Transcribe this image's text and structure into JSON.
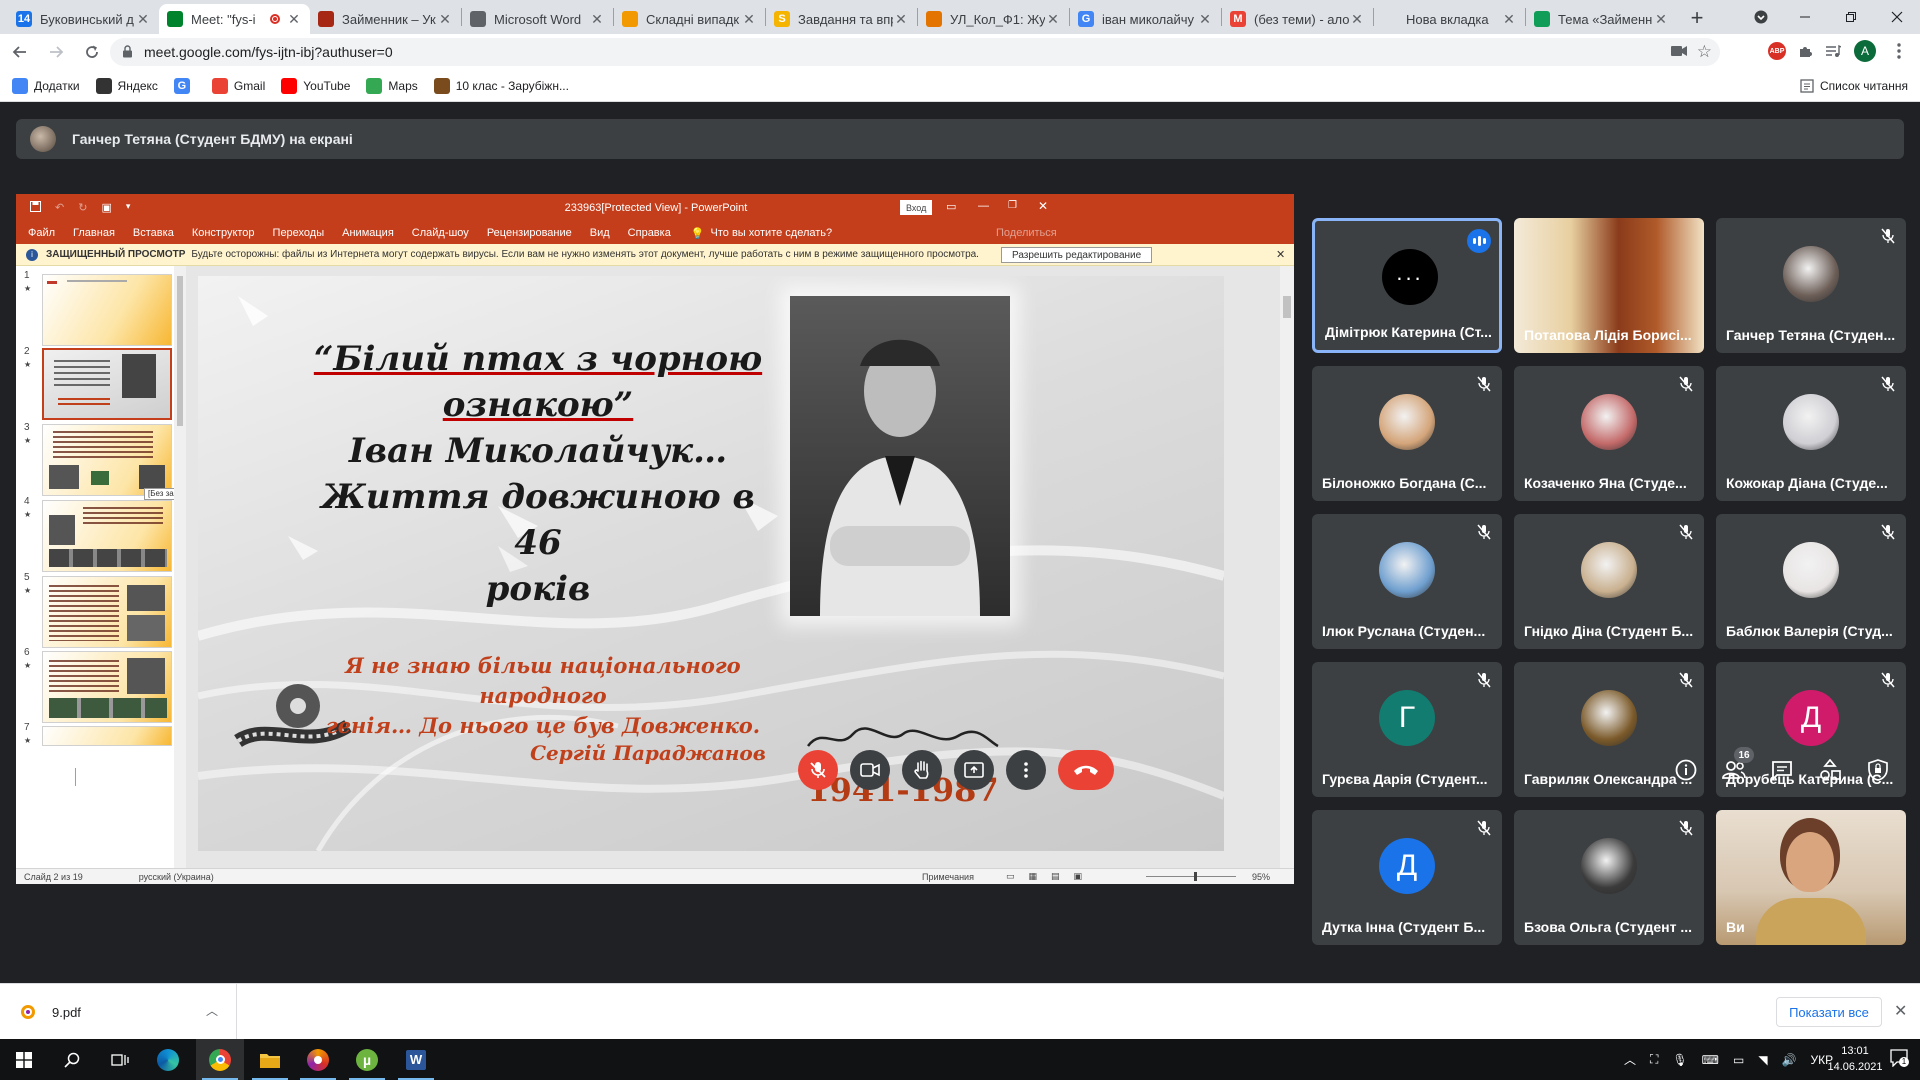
{
  "browser": {
    "tabs": [
      {
        "title": "Буковинський д",
        "color": "#1a73e8",
        "letter": "14"
      },
      {
        "title": "Meet: \"fys-i",
        "color": "#00832d",
        "letter": "",
        "active": true,
        "recording": true
      },
      {
        "title": "Займенник – Ук",
        "color": "#a52714",
        "letter": ""
      },
      {
        "title": "Microsoft Word",
        "color": "#5f6368",
        "letter": ""
      },
      {
        "title": "Складні випадк",
        "color": "#f29900",
        "letter": ""
      },
      {
        "title": "Завдання та впр",
        "color": "#f4b400",
        "letter": "S"
      },
      {
        "title": "УЛ_Кол_Ф1: Жу",
        "color": "#e37400",
        "letter": ""
      },
      {
        "title": "іван миколайчу",
        "color": "#4285f4",
        "letter": "G"
      },
      {
        "title": "(без теми) - ало",
        "color": "#ea4335",
        "letter": "M"
      },
      {
        "title": "Нова вкладка",
        "color": "#dee1e6",
        "letter": ""
      },
      {
        "title": "Тема «Займенн",
        "color": "#0f9d58",
        "letter": ""
      }
    ],
    "url": "meet.google.com/fys-ijtn-ibj?authuser=0",
    "bookmarks": [
      {
        "label": "Додатки",
        "color": "#4285f4"
      },
      {
        "label": "Яндекс",
        "color": "#333333"
      },
      {
        "label": "",
        "color": "#4285f4",
        "letter": "G"
      },
      {
        "label": "Gmail",
        "color": "#ea4335"
      },
      {
        "label": "YouTube",
        "color": "#ff0000"
      },
      {
        "label": "Maps",
        "color": "#34a853"
      },
      {
        "label": "10 клас - Зарубіжн...",
        "color": "#7a4b1c"
      }
    ],
    "reading_list": "Список читання",
    "profile_letter": "A"
  },
  "meet": {
    "presenter_text": "Ганчер Тетяна (Студент БДМУ) на екрані",
    "time": "13:01",
    "meeting_code": "fys-ijtn-ibj",
    "participants_count": "16",
    "tiles": [
      {
        "name": "Дімітрюк Катерина (Ст...",
        "type": "dots",
        "speaking": true
      },
      {
        "name": "Потапова Лідія Борисі...",
        "type": "video"
      },
      {
        "name": "Ганчер Тетяна (Студен...",
        "type": "photo",
        "color": "#6d5f58"
      },
      {
        "name": "Білоножко Богдана (С...",
        "type": "photo",
        "color": "#d4a57a"
      },
      {
        "name": "Козаченко Яна (Студе...",
        "type": "photo",
        "color": "#c46a6a"
      },
      {
        "name": "Кожокар Діана (Студе...",
        "type": "photo",
        "color": "#cfcfd4"
      },
      {
        "name": "Ілюк Руслана (Студен...",
        "type": "photo",
        "color": "#6f9fcf"
      },
      {
        "name": "Гнідко Діна (Студент Б...",
        "type": "photo",
        "color": "#c9b08f"
      },
      {
        "name": "Баблюк Валерія (Студ...",
        "type": "photo",
        "color": "#e8e4e4"
      },
      {
        "name": "Гурєва Дарія (Студент...",
        "type": "letter",
        "letter": "Г",
        "color": "#137c70"
      },
      {
        "name": "Гавриляк Олександра ...",
        "type": "photo",
        "color": "#7b5a2a"
      },
      {
        "name": "Дорубець Катерина (С...",
        "type": "letter",
        "letter": "Д",
        "color": "#d01b6b"
      },
      {
        "name": "Дутка Інна (Студент Б...",
        "type": "letter",
        "letter": "Д",
        "color": "#1a73e8"
      },
      {
        "name": "Бзова Ольга (Студент ...",
        "type": "photo",
        "color": "#3b3b3b"
      },
      {
        "name": "Ви",
        "type": "self"
      }
    ]
  },
  "ppt": {
    "window_title": "233963[Protected View] - PowerPoint",
    "signin": "Вход",
    "menu": [
      "Файл",
      "Главная",
      "Вставка",
      "Конструктор",
      "Переходы",
      "Анимация",
      "Слайд-шоу",
      "Рецензирование",
      "Вид",
      "Справка"
    ],
    "tell_me": "Что вы хотите сделать?",
    "share": "Поделиться",
    "warn_title": "ЗАЩИЩЕННЫЙ ПРОСМОТР",
    "warn_text": "Будьте осторожны: файлы из Интернета могут содержать вирусы. Если вам не нужно изменять этот документ, лучше работать с ним в режиме защищенного просмотра.",
    "enable_editing": "Разрешить редактирование",
    "thumb_numbers": [
      "1",
      "2",
      "3",
      "4",
      "5",
      "6",
      "7"
    ],
    "tooltip": "[Без заголовка]",
    "status_slide": "Слайд 2 из 19",
    "status_lang": "русский (Украина)",
    "status_notes": "Примечания",
    "zoom": "95%",
    "slide": {
      "title_line1": "“Білий птах з чорною",
      "title_line2": "ознакою”",
      "title_line3": "Іван Миколайчук…",
      "title_line4": "Життя довжиною в 46",
      "title_line5": "років",
      "quote_line1": "Я не знаю більш національного народного",
      "quote_line2": "генія… До нього це був Довженко.",
      "author": "Сергій Параджанов",
      "years": "1941-1987"
    }
  },
  "downloads": {
    "file": "9.pdf",
    "show_all": "Показати все"
  },
  "taskbar": {
    "lang": "УКР",
    "time": "13:01",
    "date": "14.06.2021",
    "notifications": "1"
  }
}
